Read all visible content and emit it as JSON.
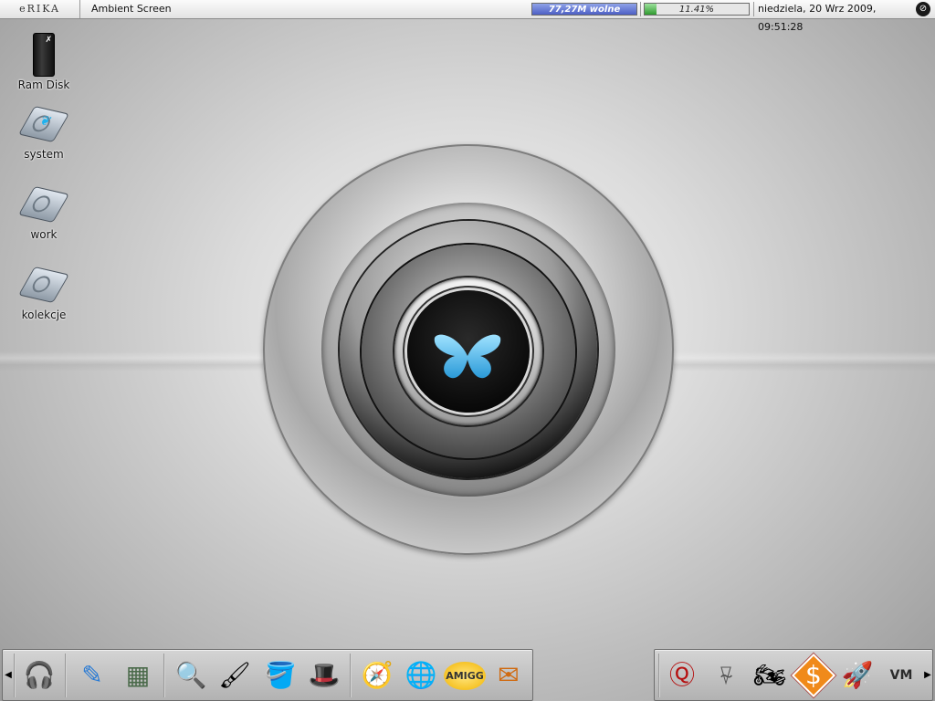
{
  "topbar": {
    "logo": "eRIKA",
    "window_title": "Ambient Screen",
    "memory_label": "77,27M wolne",
    "memory_fraction": 1.0,
    "cpu_label": "11.41%",
    "cpu_fraction": 0.1141,
    "clock": "niedziela, 20 Wrz 2009, 09:51:28",
    "depth_glyph": "⊘"
  },
  "desktop_icons": [
    {
      "label": "Ram Disk",
      "icon": "ram-disk-icon"
    },
    {
      "label": "system",
      "icon": "hard-drive-icon"
    },
    {
      "label": "work",
      "icon": "hard-drive-icon"
    },
    {
      "label": "kolekcje",
      "icon": "hard-drive-icon"
    }
  ],
  "dock_left": {
    "arrow": "◀",
    "items": [
      {
        "name": "headphones-icon",
        "glyph": "🎧"
      },
      {
        "name": "drawing-tablet-icon",
        "glyph": "✎"
      },
      {
        "name": "calculator-icon",
        "glyph": "▦"
      },
      {
        "name": "image-viewer-icon",
        "glyph": "🔍"
      },
      {
        "name": "paintbrush-icon",
        "glyph": "🖌"
      },
      {
        "name": "paint-bucket-icon",
        "glyph": "🪣"
      },
      {
        "name": "magic-hat-icon",
        "glyph": "🎩"
      },
      {
        "name": "compass-browser-icon",
        "glyph": "🧭"
      },
      {
        "name": "globe-browser-icon",
        "glyph": "🌐"
      },
      {
        "name": "amicg-icon",
        "glyph": "AMIGG"
      },
      {
        "name": "mail-icon",
        "glyph": "✉"
      }
    ]
  },
  "dock_right": {
    "arrow": "▶",
    "items": [
      {
        "name": "quake-icon",
        "glyph": "Ⓠ"
      },
      {
        "name": "quake2-icon",
        "glyph": "⍫"
      },
      {
        "name": "motorbike-game-icon",
        "glyph": "🏍"
      },
      {
        "name": "dollar-sign-icon",
        "glyph": "$"
      },
      {
        "name": "rocket-game-icon",
        "glyph": "🚀"
      },
      {
        "name": "scummvm-icon",
        "glyph": "VM"
      }
    ]
  },
  "colors": {
    "memory_bar": "#4d5fc4",
    "cpu_bar": "#2f9a2f",
    "butterfly": "#5ec8ff"
  }
}
